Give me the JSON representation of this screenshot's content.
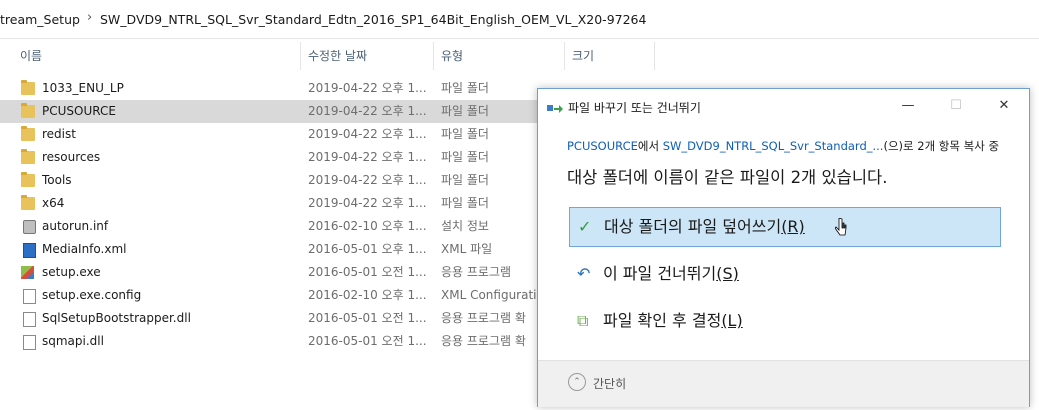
{
  "address": {
    "crumbs": [
      "tream_Setup",
      "SW_DVD9_NTRL_SQL_Svr_Standard_Edtn_2016_SP1_64Bit_English_OEM_VL_X20-97264"
    ],
    "separator": "›"
  },
  "columns": {
    "name": "이름",
    "date": "수정한 날짜",
    "type": "유형",
    "size": "크기"
  },
  "files": [
    {
      "name": "1033_ENU_LP",
      "date": "2019-04-22 오후 1...",
      "type": "파일 폴더",
      "icon": "folder-icon"
    },
    {
      "name": "PCUSOURCE",
      "date": "2019-04-22 오후 1...",
      "type": "파일 폴더",
      "icon": "folder-icon",
      "selected": true
    },
    {
      "name": "redist",
      "date": "2019-04-22 오후 1...",
      "type": "파일 폴더",
      "icon": "folder-icon"
    },
    {
      "name": "resources",
      "date": "2019-04-22 오후 1...",
      "type": "파일 폴더",
      "icon": "folder-icon"
    },
    {
      "name": "Tools",
      "date": "2019-04-22 오후 1...",
      "type": "파일 폴더",
      "icon": "folder-icon"
    },
    {
      "name": "x64",
      "date": "2019-04-22 오후 1...",
      "type": "파일 폴더",
      "icon": "folder-icon"
    },
    {
      "name": "autorun.inf",
      "date": "2016-02-10 오후 1...",
      "type": "설치 정보",
      "icon": "settings-file-icon"
    },
    {
      "name": "MediaInfo.xml",
      "date": "2016-05-01 오후 1...",
      "type": "XML 파일",
      "icon": "xml-file-icon"
    },
    {
      "name": "setup.exe",
      "date": "2016-05-01 오전 1...",
      "type": "응용 프로그램",
      "icon": "exe-icon"
    },
    {
      "name": "setup.exe.config",
      "date": "2016-02-10 오후 1...",
      "type": "XML Configuratio",
      "icon": "file-icon"
    },
    {
      "name": "SqlSetupBootstrapper.dll",
      "date": "2016-05-01 오전 1...",
      "type": "응용 프로그램 확",
      "icon": "file-icon"
    },
    {
      "name": "sqmapi.dll",
      "date": "2016-05-01 오전 1...",
      "type": "응용 프로그램 확",
      "icon": "file-icon"
    }
  ],
  "dialog": {
    "title": "파일 바꾸기 또는 건너뛰기",
    "minimize": "—",
    "maximize": "☐",
    "close": "✕",
    "source_link": "PCUSOURCE",
    "source_mid": "에서 ",
    "dest_link": "SW_DVD9_NTRL_SQL_Svr_Standard_...",
    "source_tail": "(으)로 2개 항목 복사 중",
    "heading": "대상 폴더에 이름이 같은 파일이 2개 있습니다.",
    "options": [
      {
        "label": "대상 폴더의 파일 덮어쓰기",
        "accel": "(R)",
        "icon": "checkmark-icon",
        "glyph": "✓",
        "color": "#2e9e3c"
      },
      {
        "label": "이 파일 건너뛰기",
        "accel": "(S)",
        "icon": "skip-arrow-icon",
        "glyph": "↶",
        "color": "#2a6fc4"
      },
      {
        "label": "파일 확인 후 결정",
        "accel": "(L)",
        "icon": "decide-files-icon",
        "glyph": "⧉",
        "color": "#6aa84f"
      }
    ],
    "fewer_details": "간단히"
  }
}
